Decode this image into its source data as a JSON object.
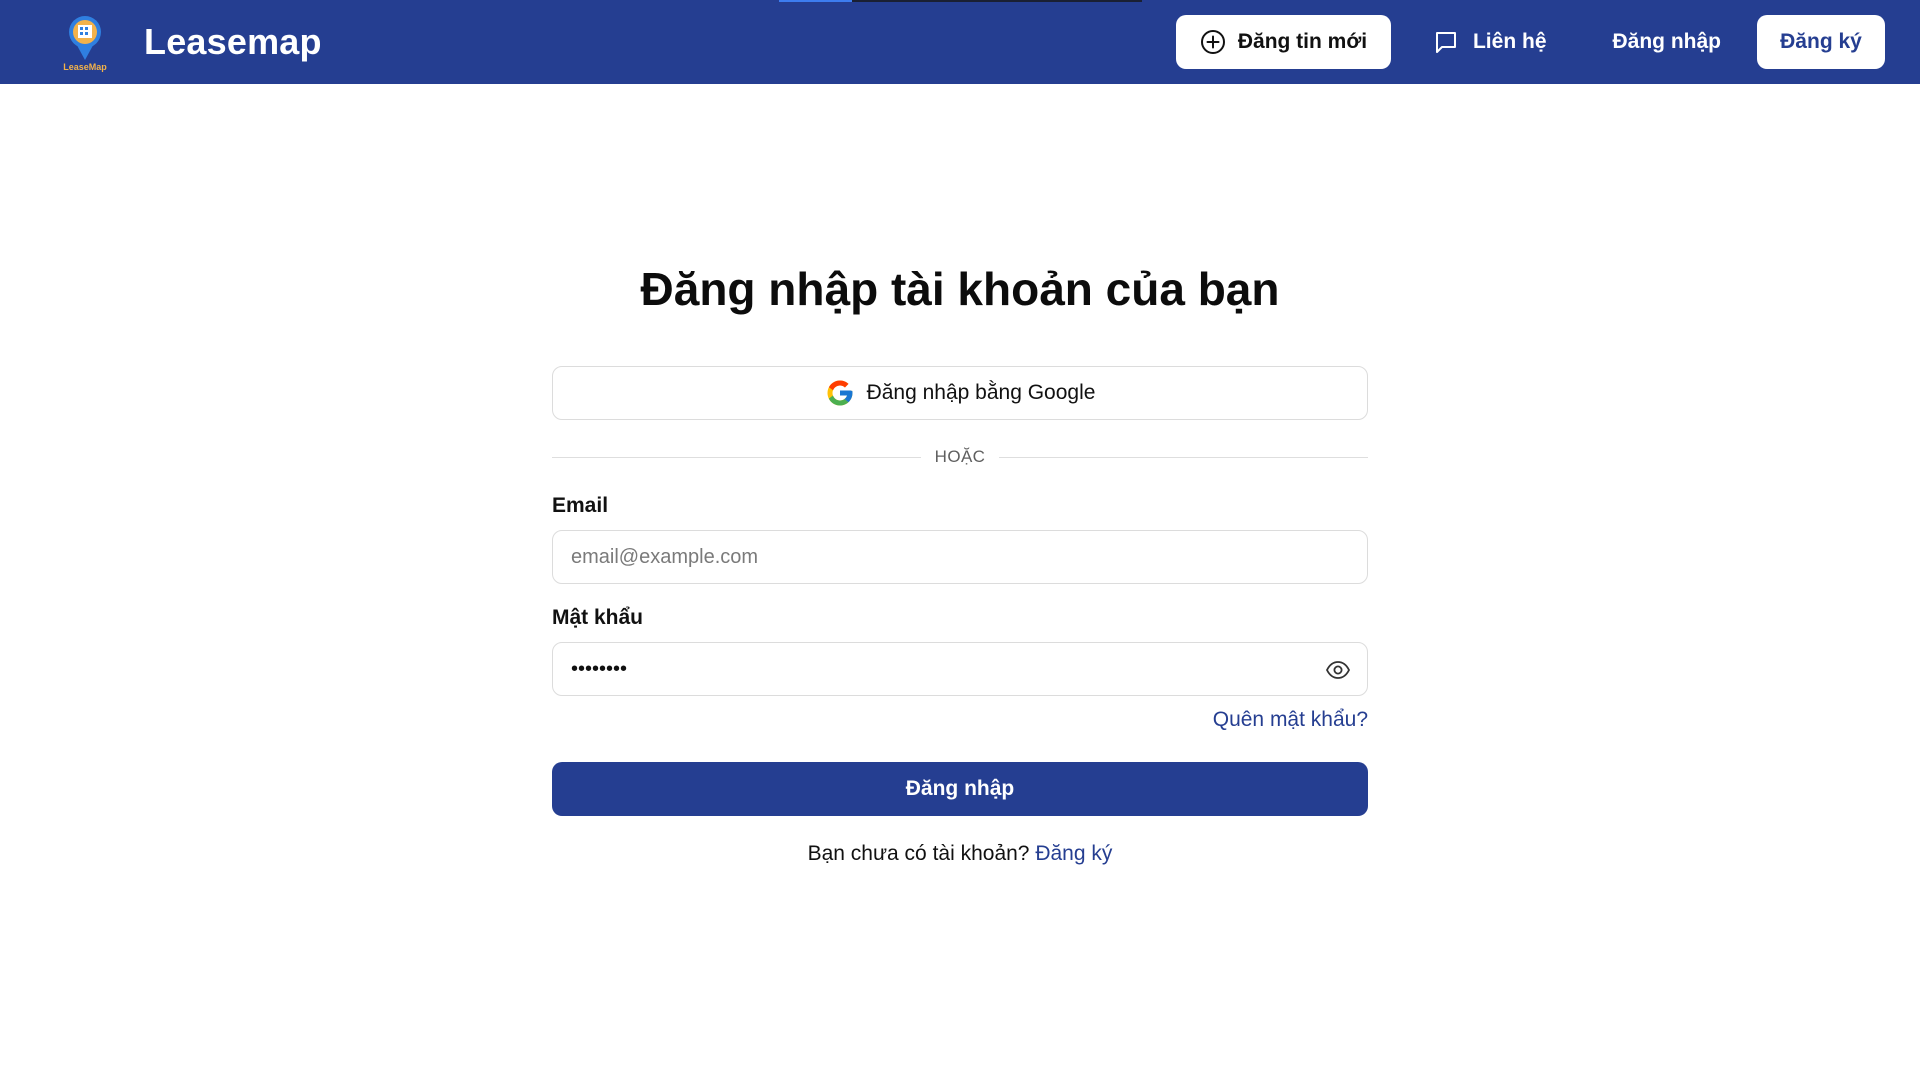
{
  "header": {
    "brand_name": "Leasemap",
    "logo_text": "LeaseMap",
    "post_button_label": "Đăng tin mới",
    "post_button_icon": "plus-circle-icon",
    "contact_label": "Liên hệ",
    "contact_icon": "chat-bubble-icon",
    "login_label": "Đăng nhập",
    "register_label": "Đăng ký",
    "loading_progress": 0.2
  },
  "form": {
    "title": "Đăng nhập tài khoản của bạn",
    "google_button_label": "Đăng nhập bằng Google",
    "divider_text": "HOẶC",
    "email_label": "Email",
    "email_placeholder": "email@example.com",
    "email_value": "",
    "password_label": "Mật khẩu",
    "password_value": "••••••••",
    "password_toggle_icon": "eye-icon",
    "forgot_password_label": "Quên mật khẩu?",
    "submit_label": "Đăng nhập",
    "no_account_text": "Bạn chưa có tài khoản?",
    "signup_link_label": "Đăng ký"
  },
  "colors": {
    "brand_blue": "#253e91",
    "progress_blue": "#3d7df0",
    "white": "#ffffff",
    "border_gray": "#dcdcdc"
  }
}
